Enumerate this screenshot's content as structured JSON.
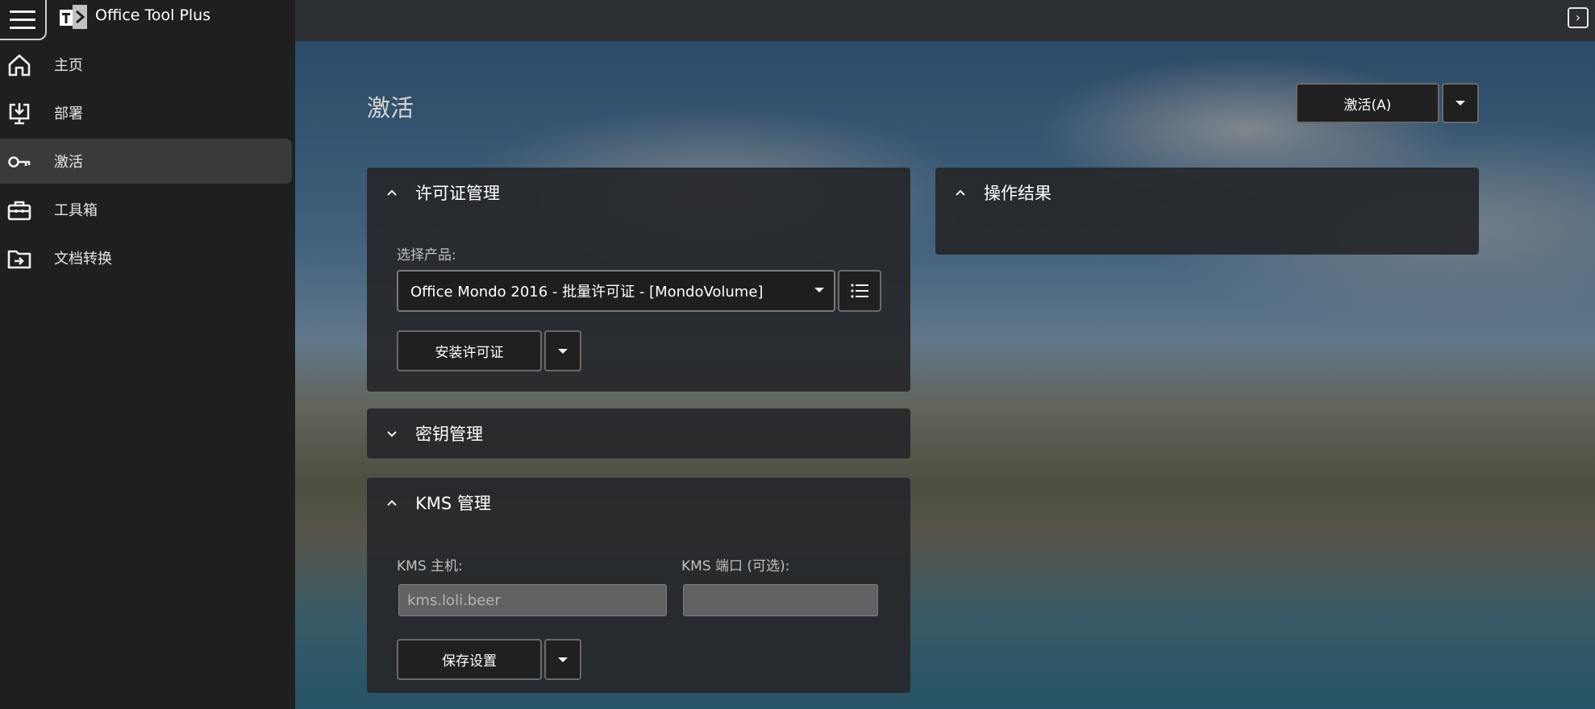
{
  "app": {
    "title": "Office Tool Plus"
  },
  "sidebar": {
    "items": [
      {
        "label": "主页",
        "icon": "home-icon"
      },
      {
        "label": "部署",
        "icon": "deploy-icon"
      },
      {
        "label": "激活",
        "icon": "key-icon",
        "active": true
      },
      {
        "label": "工具箱",
        "icon": "toolbox-icon"
      },
      {
        "label": "文档转换",
        "icon": "document-convert-icon"
      }
    ]
  },
  "page": {
    "title": "激活",
    "activate_button": "激活(A)"
  },
  "license_card": {
    "title": "许可证管理",
    "product_label": "选择产品:",
    "product_value": "Office Mondo 2016 - 批量许可证 - [MondoVolume]",
    "install_button": "安装许可证"
  },
  "key_card": {
    "title": "密钥管理"
  },
  "kms_card": {
    "title": "KMS 管理",
    "host_label": "KMS 主机:",
    "host_placeholder": "kms.loli.beer",
    "port_label": "KMS 端口 (可选):",
    "port_value": "",
    "save_button": "保存设置"
  },
  "result_card": {
    "title": "操作结果"
  },
  "colors": {
    "sidebar_bg": "#1f1f1f",
    "active_item_bg": "#3a3a3a",
    "card_bg": "#26282c",
    "button_bg": "#202020"
  }
}
